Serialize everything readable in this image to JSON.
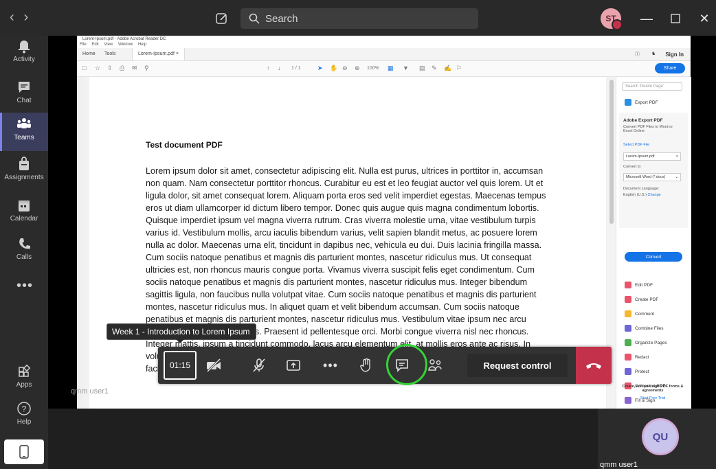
{
  "titlebar": {
    "search_placeholder": "Search",
    "avatar_initials": "ST"
  },
  "sidebar": {
    "items": [
      {
        "label": "Activity"
      },
      {
        "label": "Chat"
      },
      {
        "label": "Teams"
      },
      {
        "label": "Assignments"
      },
      {
        "label": "Calendar"
      },
      {
        "label": "Calls"
      },
      {
        "label": "Apps"
      },
      {
        "label": "Help"
      }
    ],
    "more_label": "•••",
    "active": "Teams",
    "accent": "#7b83eb"
  },
  "acrobat": {
    "window_title": "Lorem-Ipsum.pdf - Adobe Acrobat Reader DC",
    "menu": [
      "File",
      "Edit",
      "View",
      "Window",
      "Help"
    ],
    "tabs": {
      "home": "Home",
      "tools": "Tools",
      "document": "Lorem-Ipsum.pdf"
    },
    "sign_in": "Sign In",
    "share": "Share",
    "page_display": "1 / 1",
    "zoom": "100%",
    "document": {
      "heading": "Test document PDF",
      "body": "Lorem ipsum dolor sit amet, consectetur adipiscing elit. Nulla est purus, ultrices in porttitor in, accumsan non quam. Nam consectetur porttitor rhoncus. Curabitur eu est et leo feugiat auctor vel quis lorem. Ut et ligula dolor, sit amet consequat lorem. Aliquam porta eros sed velit imperdiet egestas. Maecenas tempus eros ut diam ullamcorper id dictum libero tempor. Donec quis augue quis magna condimentum lobortis. Quisque imperdiet ipsum vel magna viverra rutrum. Cras viverra molestie urna, vitae vestibulum turpis varius id. Vestibulum mollis, arcu iaculis bibendum varius, velit sapien blandit metus, ac posuere lorem nulla ac dolor. Maecenas urna elit, tincidunt in dapibus nec, vehicula eu dui. Duis lacinia fringilla massa. Cum sociis natoque penatibus et magnis dis parturient montes, nascetur ridiculus mus. Ut consequat ultricies est, non rhoncus mauris congue porta. Vivamus viverra suscipit felis eget condimentum. Cum sociis natoque penatibus et magnis dis parturient montes, nascetur ridiculus mus. Integer bibendum sagittis ligula, non faucibus nulla volutpat vitae. Cum sociis natoque penatibus et magnis dis parturient montes, nascetur ridiculus mus. In aliquet quam et velit bibendum accumsan. Cum sociis natoque penatibus et magnis dis parturient montes, nascetur ridiculus mus. Vestibulum vitae ipsum nec arcu semper adipiscing at ac lacus. Praesent id pellentesque orci. Morbi congue viverra nisl nec rhoncus. Integer mattis, ipsum a tincidunt commodo, lacus arcu elementum elit, at mollis eros ante ac risus. In volutpat, ante at pretium ultricies, velit magna suscipit enim, aliquet blandit massa orci nec lorem. Nulla facilisi. Duis eu vehicula arcu. Nulla facilisi. Maecenas pellentesque"
    },
    "right_pane": {
      "search_placeholder": "Search 'Delete Page'",
      "export_pdf": "Export PDF",
      "export_title": "Adobe Export PDF",
      "export_desc": "Convert PDF Files to Word or Excel Online",
      "select_file": "Select PDF File",
      "file_name": "Lorem-Ipsum.pdf",
      "convert_to": "Convert to",
      "format": "Microsoft Word (*.docx)",
      "doc_lang_label": "Document Language:",
      "doc_lang": "English (U.S.)",
      "change": "Change",
      "convert": "Convert",
      "tools": [
        "Edit PDF",
        "Create PDF",
        "Comment",
        "Combine Files",
        "Organize Pages",
        "Redact",
        "Protect",
        "Compress PDF",
        "Fill & Sign"
      ],
      "promo_title": "Create, edit and sign PDF forms & agreements",
      "promo_link": "Start Free Trial"
    }
  },
  "meeting": {
    "tooltip": "Week 1 - Introduction to Lorem Ipsum",
    "timer": "01:15",
    "request_control": "Request control",
    "presenter_label": "qmm user1",
    "participant_initials": "QU",
    "participant_name": "qmm user1",
    "colors": {
      "hangup": "#c4314b",
      "highlight_ring": "#35d335"
    }
  }
}
